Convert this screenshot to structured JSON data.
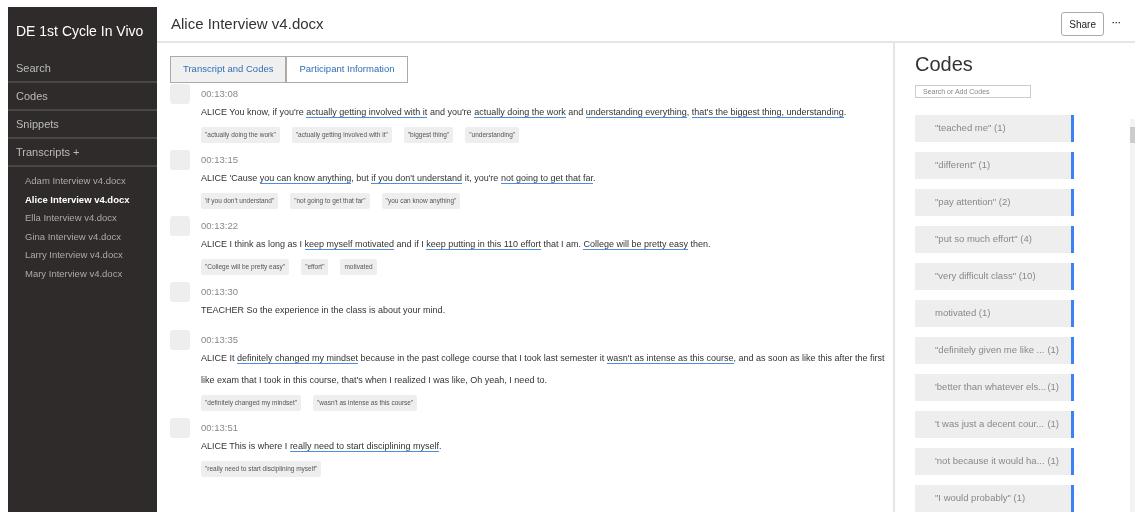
{
  "project": {
    "title": "DE 1st Cycle In Vivo"
  },
  "sidebar": {
    "items": [
      {
        "label": "Search"
      },
      {
        "label": "Codes"
      },
      {
        "label": "Snippets"
      },
      {
        "label": "Transcripts +"
      }
    ],
    "transcripts": [
      {
        "label": "Adam Interview v4.docx",
        "selected": false
      },
      {
        "label": "Alice Interview v4.docx",
        "selected": true
      },
      {
        "label": "Ella Interview v4.docx",
        "selected": false
      },
      {
        "label": "Gina Interview v4.docx",
        "selected": false
      },
      {
        "label": "Larry Interview v4.docx",
        "selected": false
      },
      {
        "label": "Mary Interview v4.docx",
        "selected": false
      }
    ]
  },
  "header": {
    "title": "Alice Interview v4.docx",
    "share": "Share",
    "more": "···"
  },
  "tabs": [
    {
      "label": "Transcript and Codes",
      "selected": true
    },
    {
      "label": "Participant Information",
      "selected": false
    }
  ],
  "utterances": [
    {
      "time": "00:13:08",
      "speaker": "ALICE",
      "segments": [
        {
          "text": " You know, if you're ",
          "coded": false
        },
        {
          "text": "actually getting involved with it",
          "coded": true
        },
        {
          "text": " and you're ",
          "coded": false
        },
        {
          "text": "actually doing the work",
          "coded": true
        },
        {
          "text": " and ",
          "coded": false
        },
        {
          "text": "understanding everything",
          "coded": true
        },
        {
          "text": ", ",
          "coded": false
        },
        {
          "text": "that's the biggest thing, understanding",
          "coded": true
        },
        {
          "text": ".",
          "coded": false
        }
      ],
      "tags": [
        "\"actually doing the work\"",
        "\"actually getting involved with it\"",
        "\"biggest thing\"",
        "\"understanding\""
      ]
    },
    {
      "time": "00:13:15",
      "speaker": "ALICE",
      "segments": [
        {
          "text": " 'Cause ",
          "coded": false
        },
        {
          "text": "you can know anything",
          "coded": true
        },
        {
          "text": ", but ",
          "coded": false
        },
        {
          "text": "if you don't understand",
          "coded": true
        },
        {
          "text": " it, you're ",
          "coded": false
        },
        {
          "text": "not going to get that far",
          "coded": true
        },
        {
          "text": ".",
          "coded": false
        }
      ],
      "tags": [
        "'if you don't understand\"",
        "\"not going to get that far\"",
        "\"you can know anything\""
      ]
    },
    {
      "time": "00:13:22",
      "speaker": "ALICE",
      "segments": [
        {
          "text": " I think as long as I ",
          "coded": false
        },
        {
          "text": "keep myself motivated",
          "coded": true
        },
        {
          "text": " and if I ",
          "coded": false
        },
        {
          "text": "keep putting in this 110 effort",
          "coded": true
        },
        {
          "text": " that I am. ",
          "coded": false
        },
        {
          "text": "College will be pretty easy",
          "coded": true
        },
        {
          "text": " then.",
          "coded": false
        }
      ],
      "tags": [
        "\"College will be pretty easy\"",
        "\"effort\"",
        "motivated"
      ]
    },
    {
      "time": "00:13:30",
      "speaker": "TEACHER",
      "segments": [
        {
          "text": " So the experience in the class is about your mind.",
          "coded": false
        }
      ]
    },
    {
      "time": "00:13:35",
      "speaker": "ALICE",
      "segments": [
        {
          "text": " It ",
          "coded": false
        },
        {
          "text": "definitely changed my mindset",
          "coded": true
        },
        {
          "text": " because in the past college course that I took last semester it ",
          "coded": false
        },
        {
          "text": "wasn't as intense as this course",
          "coded": true
        },
        {
          "text": ", and as soon as like this after the first like exam that I took in this course, that's when I realized I was like, Oh yeah, I need to.",
          "coded": false
        }
      ],
      "tags": [
        "\"definitely changed my mindset\"",
        "\"wasn't as intense as this course\""
      ]
    },
    {
      "time": "00:13:51",
      "speaker": "ALICE",
      "segments": [
        {
          "text": " This is where I ",
          "coded": false
        },
        {
          "text": "really need to start disciplining myself",
          "coded": true
        },
        {
          "text": ".",
          "coded": false
        }
      ],
      "tags": [
        "\"really need to start disciplining myself\""
      ]
    }
  ],
  "codes_panel": {
    "title": "Codes",
    "search_placeholder": "Search or Add Codes",
    "codes": [
      {
        "label": "\"teached me\" (1)"
      },
      {
        "label": "\"different\" (1)"
      },
      {
        "label": "\"pay attention\" (2)"
      },
      {
        "label": "\"put so much effort\" (4)"
      },
      {
        "label": "\"very difficult class\" (10)"
      },
      {
        "label": "motivated (1)"
      },
      {
        "label": "\"definitely given me like ...",
        "count": "(1)"
      },
      {
        "label": "'better than whatever els...",
        "count": "(1)"
      },
      {
        "label": "'t was just a decent cour...",
        "count": "(1)"
      },
      {
        "label": "'not because it would ha...",
        "count": "(1)"
      },
      {
        "label": "\"I would probably\" (1)"
      }
    ]
  }
}
